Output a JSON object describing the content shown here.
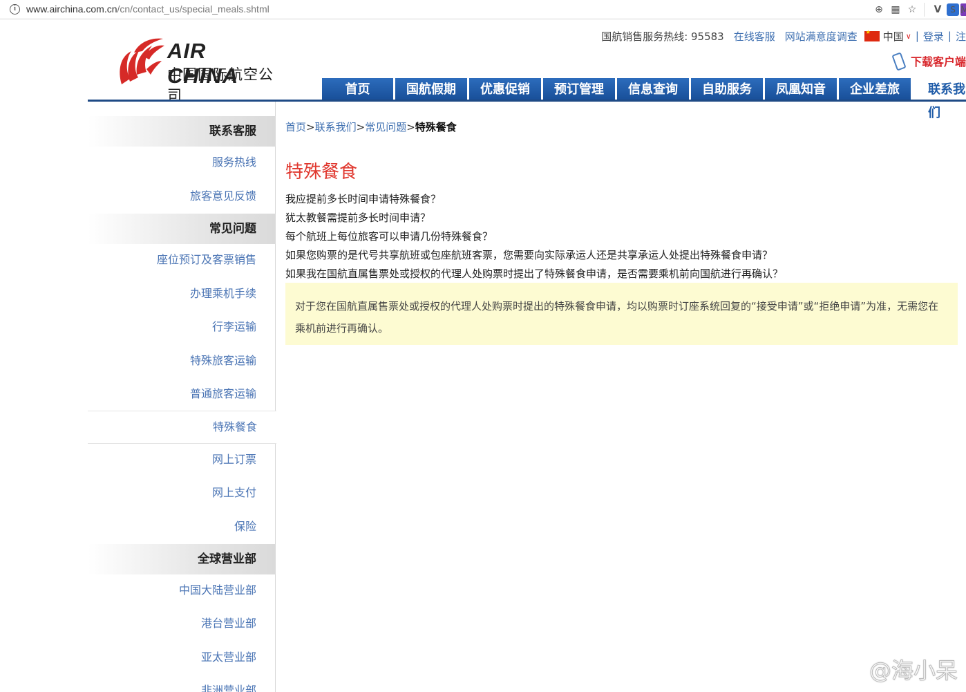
{
  "browser": {
    "url_domain": "www.airchina.com.cn",
    "url_path": "/cn/contact_us/special_meals.shtml",
    "icons": [
      "info-icon",
      "zoom-icon",
      "qr-icon",
      "star-icon",
      "extension-v-icon",
      "extension-s-icon",
      "extension-m-icon"
    ]
  },
  "logo": {
    "en": "AIR CHINA",
    "cn": "中国国际航空公司"
  },
  "topbar": {
    "hotline": "国航销售服务热线: 95583",
    "online_service": "在线客服",
    "survey": "网站满意度调查",
    "region": "中国",
    "login": "登录",
    "register": "注",
    "download": "下载客户端"
  },
  "nav": {
    "items": [
      "首页",
      "国航假期",
      "优惠促销",
      "预订管理",
      "信息查询",
      "自助服务",
      "凤凰知音",
      "企业差旅",
      "联系我们"
    ]
  },
  "sidebar": {
    "sections": [
      {
        "title": "联系客服",
        "items": [
          "服务热线",
          "旅客意见反馈"
        ]
      },
      {
        "title": "常见问题",
        "items": [
          "座位预订及客票销售",
          "办理乘机手续",
          "行李运输",
          "特殊旅客运输",
          "普通旅客运输",
          "特殊餐食",
          "网上订票",
          "网上支付",
          "保险"
        ]
      },
      {
        "title": "全球营业部",
        "items": [
          "中国大陆营业部",
          "港台营业部",
          "亚太营业部",
          "非洲营业部"
        ]
      }
    ]
  },
  "breadcrumb": {
    "home": "首页",
    "contact": "联系我们",
    "faq": "常见问题",
    "current": "特殊餐食",
    "sep": ">"
  },
  "page": {
    "title": "特殊餐食",
    "questions": [
      "我应提前多长时间申请特殊餐食？",
      "犹太教餐需提前多长时间申请？",
      "每个航班上每位旅客可以申请几份特殊餐食？",
      "如果您购票的是代号共享航班或包座航班客票，您需要向实际承运人还是共享承运人处提出特殊餐食申请？",
      "如果我在国航直属售票处或授权的代理人处购票时提出了特殊餐食申请，是否需要乘机前向国航进行再确认？"
    ],
    "answer": "对于您在国航直属售票处或授权的代理人处购票时提出的特殊餐食申请，均以购票时订座系统回复的“接受申请”或“拒绝申请”为准，无需您在乘机前进行再确认。"
  },
  "watermark": "@海小呆",
  "colors": {
    "nav_blue": "#1e5ba8",
    "link_blue": "#3e6fb0",
    "title_red": "#e0382f",
    "answer_bg": "#fdfbd2"
  }
}
